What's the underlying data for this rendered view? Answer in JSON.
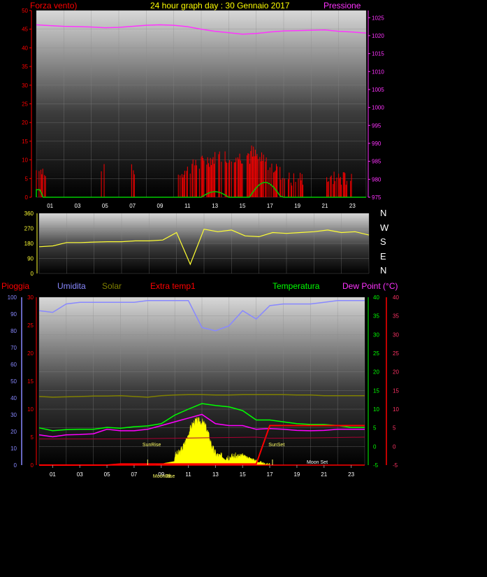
{
  "header": {
    "title": "24 hour graph day : 30 Gennaio 2017",
    "left_label": "Forza vento)",
    "right_label": "Pressione"
  },
  "colors": {
    "wind": "#ff0000",
    "gust": "#ff0000",
    "wind_avg": "#00cc00",
    "pressure": "#ff33ff",
    "direction": "#ffff33",
    "humidity": "#8888ff",
    "solar": "#808000",
    "extra_temp": "#ff0000",
    "temperature": "#00ff00",
    "dew_point": "#ff00ff",
    "rain": "#ff0000",
    "rain_axis": "#8888ff"
  },
  "x_ticks": [
    "01",
    "03",
    "05",
    "07",
    "09",
    "11",
    "13",
    "15",
    "17",
    "19",
    "21",
    "23"
  ],
  "wind_panel": {
    "left_ticks": [
      "50",
      "45",
      "40",
      "35",
      "30",
      "25",
      "20",
      "15",
      "10",
      "5",
      "0"
    ],
    "right_ticks": [
      "1025",
      "1020",
      "1015",
      "1010",
      "1005",
      "1000",
      "995",
      "990",
      "985",
      "980",
      "975"
    ]
  },
  "direction_panel": {
    "ticks": [
      "360",
      "270",
      "180",
      "90",
      "0"
    ],
    "compass": [
      "N",
      "W",
      "S",
      "E",
      "N"
    ]
  },
  "multi_panel": {
    "legend": {
      "rain": "Pioggia",
      "humidity": "Umidita",
      "solar": "Solar",
      "extra_temp": "Extra temp1",
      "temperature": "Temperatura",
      "dew_point": "Dew Point (°C)"
    },
    "humidity_ticks": [
      "100",
      "90",
      "80",
      "70",
      "60",
      "50",
      "40",
      "30",
      "20",
      "10",
      "0"
    ],
    "rain_ticks": [
      "30",
      "25",
      "20",
      "15",
      "10",
      "5",
      "0"
    ],
    "temp_ticks": [
      "40",
      "35",
      "30",
      "25",
      "20",
      "15",
      "10",
      "5",
      "0",
      "-5"
    ],
    "dew_ticks": [
      "40",
      "35",
      "30",
      "25",
      "20",
      "15",
      "10",
      "5",
      "0",
      "-5"
    ],
    "events": {
      "sunrise": "SunRise",
      "sunset": "SunSet",
      "moonrise": "MoonRise",
      "moonset": "Moon Set",
      "moon_phase": "08"
    }
  },
  "chart_data": [
    {
      "type": "line",
      "title": "24 hour graph day : 30 Gennaio 2017",
      "ylabel": "Forza vento)",
      "ylabel_right": "Pressione",
      "ylim": [
        0,
        50
      ],
      "ylim_right": [
        975,
        1027
      ],
      "x": [
        0,
        1,
        2,
        3,
        4,
        5,
        6,
        7,
        8,
        9,
        10,
        11,
        12,
        13,
        14,
        15,
        16,
        17,
        18,
        19,
        20,
        21,
        22,
        23,
        24
      ],
      "series": [
        {
          "name": "Pressione",
          "axis": "right",
          "values": [
            1023,
            1022.8,
            1022.6,
            1022.5,
            1022.4,
            1022.2,
            1022.3,
            1022.6,
            1022.9,
            1023,
            1022.9,
            1022.5,
            1021.8,
            1021.2,
            1020.8,
            1020.4,
            1020.6,
            1021,
            1021.3,
            1021.4,
            1021.5,
            1021.6,
            1021.2,
            1021,
            1020.7
          ]
        }
      ]
    },
    {
      "type": "line",
      "ylim": [
        0,
        360
      ],
      "x": [
        0,
        1,
        2,
        3,
        4,
        5,
        6,
        7,
        8,
        9,
        10,
        11,
        12,
        13,
        14,
        15,
        16,
        17,
        18,
        19,
        20,
        21,
        22,
        23,
        24
      ],
      "series": [
        {
          "name": "direction",
          "values": [
            160,
            165,
            185,
            185,
            188,
            190,
            190,
            195,
            195,
            200,
            245,
            55,
            265,
            250,
            260,
            225,
            220,
            245,
            240,
            245,
            250,
            260,
            245,
            250,
            230
          ]
        }
      ]
    },
    {
      "type": "line",
      "x": [
        0,
        1,
        2,
        3,
        4,
        5,
        6,
        7,
        8,
        9,
        10,
        11,
        12,
        13,
        14,
        15,
        16,
        17,
        18,
        19,
        20,
        21,
        22,
        23,
        24
      ],
      "series": [
        {
          "name": "Umidita",
          "axis": "humidity",
          "ylim": [
            0,
            100
          ],
          "values": [
            92,
            91,
            96,
            97,
            97,
            97,
            97,
            97,
            98,
            98,
            98,
            98,
            82,
            80,
            83,
            92,
            87,
            95,
            96,
            96,
            96,
            97,
            98,
            98,
            98
          ]
        },
        {
          "name": "Temperatura",
          "axis": "temp",
          "ylim": [
            -5,
            40
          ],
          "values": [
            5,
            4.2,
            4.5,
            4.6,
            4.6,
            5.1,
            4.9,
            5.3,
            5.5,
            6.1,
            8.4,
            10,
            11.5,
            11,
            10.6,
            9.6,
            7.1,
            7.1,
            6.6,
            6.1,
            5.9,
            5.9,
            5.6,
            5.1,
            5.1
          ]
        },
        {
          "name": "Dew Point (°C)",
          "axis": "temp",
          "ylim": [
            -5,
            40
          ],
          "values": [
            3.1,
            2.6,
            3.1,
            3.2,
            3.4,
            4.6,
            4.2,
            4.2,
            4.6,
            5.6,
            6.6,
            7.6,
            8.6,
            6.1,
            5.6,
            5.6,
            4.6,
            4.8,
            4.6,
            4.3,
            4.2,
            4.3,
            4.6,
            4.6,
            4.6
          ]
        },
        {
          "name": "Solar",
          "axis": "temp",
          "ylim": [
            -5,
            40
          ],
          "values": [
            13.4,
            13.2,
            13.3,
            13.4,
            13.5,
            13.5,
            13.6,
            13.4,
            13.2,
            13.6,
            13.8,
            13.9,
            13.9,
            13.8,
            13.8,
            13.9,
            13.9,
            13.9,
            13.9,
            13.8,
            13.8,
            13.6,
            13.6,
            13.6,
            13.6
          ]
        },
        {
          "name": "Extra temp1",
          "axis": "temp",
          "ylim": [
            -5,
            40
          ],
          "values": [
            -5,
            -5,
            -5,
            -5,
            -5,
            -5,
            -4.7,
            -4.7,
            -4.7,
            -4.7,
            -4.7,
            -4.7,
            -4.7,
            -4.7,
            -4.7,
            -4.7,
            -4.7,
            5.6,
            5.6,
            5.6,
            5.6,
            5.6,
            5.6,
            5.6,
            5.6
          ]
        },
        {
          "name": "Pioggia",
          "axis": "rain",
          "ylim": [
            0,
            30
          ],
          "values": [
            0,
            0,
            0,
            0,
            0,
            0,
            0,
            0,
            0,
            0,
            0,
            0,
            0,
            0,
            0,
            0,
            0,
            0,
            0,
            0,
            0,
            0,
            0,
            0,
            0
          ]
        }
      ]
    }
  ]
}
